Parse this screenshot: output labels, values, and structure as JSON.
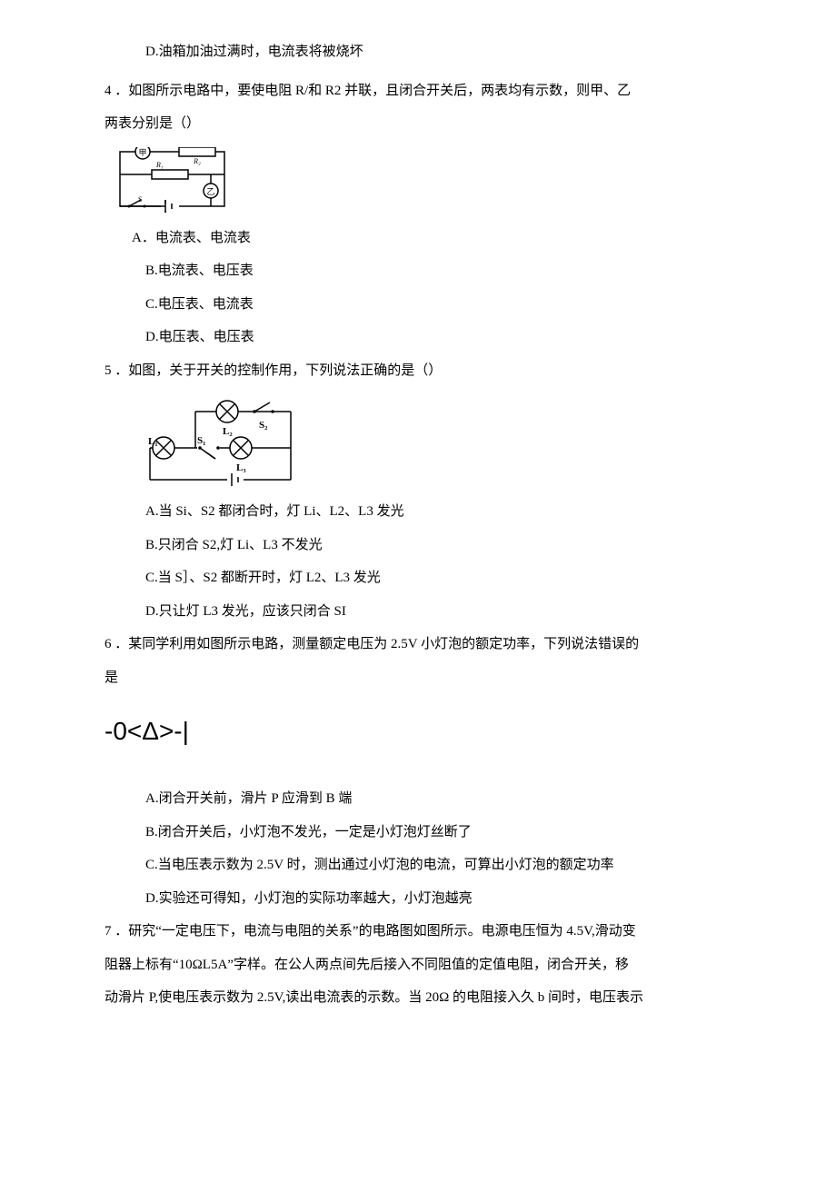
{
  "q3optD": "D.油箱加油过满时，电流表将被烧坏",
  "q4stem1": "4 ．如图所示电路中，要使电阻 R/和 R2 并联，且闭合开关后，两表均有示数，则甲、乙",
  "q4stem2": "两表分别是（）",
  "q4optA": "A．电流表、电流表",
  "q4optB": "B.电流表、电压表",
  "q4optC": "C.电压表、电流表",
  "q4optD": "D.电压表、电压表",
  "q5stem": "5 ．如图，关于开关的控制作用，下列说法正确的是（）",
  "q5optA": "A.当 Si、S2 都闭合时，灯 Li、L2、L3 发光",
  "q5optB": "B.只闭合 S2,灯 Li、L3 不发光",
  "q5optC": "C.当 S］、S2 都断开时，灯 L2、L3 发光",
  "q5optD": "D.只让灯 L3 发光，应该只闭合 SI",
  "q6stem1": "6 ．某同学利用如图所示电路，测量额定电压为 2.5V 小灯泡的额定功率，下列说法错误的",
  "q6stem2": "是",
  "q6diagram": "-0<Δ>-|",
  "q6optA": "A.闭合开关前，滑片 P 应滑到 B 端",
  "q6optB": "B.闭合开关后，小灯泡不发光，一定是小灯泡灯丝断了",
  "q6optC": "C.当电压表示数为 2.5V 时，测出通过小灯泡的电流，可算出小灯泡的额定功率",
  "q6optD": "D.实验还可得知，小灯泡的实际功率越大，小灯泡越亮",
  "q7stem1": "7 ．研究“一定电压下，电流与电阻的关系”的电路图如图所示。电源电压恒为 4.5V,滑动变",
  "q7stem2": "阻器上标有“10ΩL5A”字样。在公人两点间先后接入不同阻值的定值电阻，闭合开关，移",
  "q7stem3": "动滑片 P,使电压表示数为 2.5V,读出电流表的示数。当 20Ω 的电阻接入久 b 间时，电压表示",
  "diag4": {
    "R1": "R₁",
    "R2": "R₂",
    "S": "S",
    "meter1": "甲",
    "meter2": "乙"
  },
  "diag5": {
    "L1": "L₁",
    "L2": "L₂",
    "L3": "L₃",
    "S1": "S₁",
    "S2": "S₂"
  }
}
